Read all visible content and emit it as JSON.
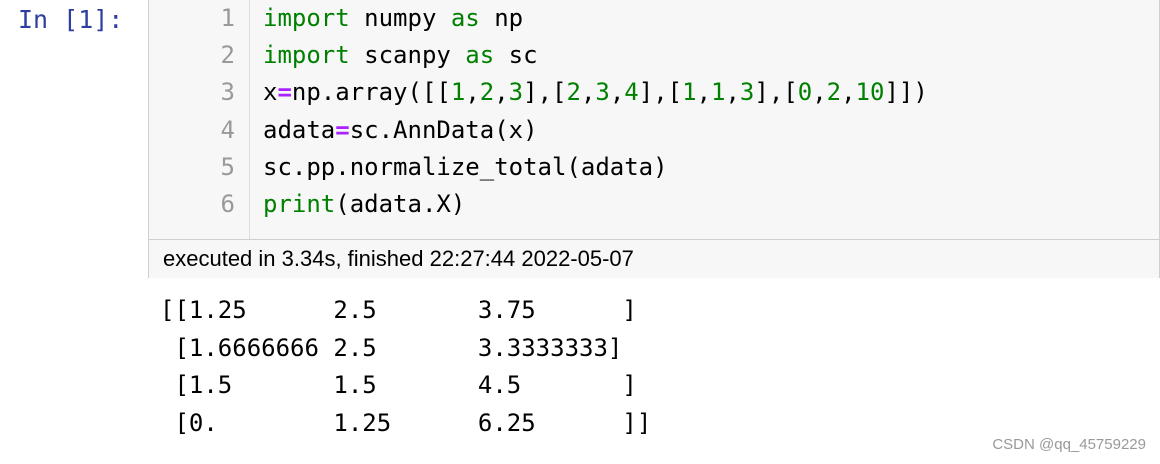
{
  "cell": {
    "prompt": "In [1]:",
    "line_numbers": [
      "1",
      "2",
      "3",
      "4",
      "5",
      "6"
    ],
    "code_lines": [
      [
        {
          "t": "import",
          "c": "kw"
        },
        {
          "t": " numpy ",
          "c": ""
        },
        {
          "t": "as",
          "c": "kw"
        },
        {
          "t": " np",
          "c": ""
        }
      ],
      [
        {
          "t": "import",
          "c": "kw"
        },
        {
          "t": " scanpy ",
          "c": ""
        },
        {
          "t": "as",
          "c": "kw"
        },
        {
          "t": " sc",
          "c": ""
        }
      ],
      [
        {
          "t": "x",
          "c": ""
        },
        {
          "t": "=",
          "c": "op"
        },
        {
          "t": "np.array([[",
          "c": ""
        },
        {
          "t": "1",
          "c": "num"
        },
        {
          "t": ",",
          "c": ""
        },
        {
          "t": "2",
          "c": "num"
        },
        {
          "t": ",",
          "c": ""
        },
        {
          "t": "3",
          "c": "num"
        },
        {
          "t": "],[",
          "c": ""
        },
        {
          "t": "2",
          "c": "num"
        },
        {
          "t": ",",
          "c": ""
        },
        {
          "t": "3",
          "c": "num"
        },
        {
          "t": ",",
          "c": ""
        },
        {
          "t": "4",
          "c": "num"
        },
        {
          "t": "],[",
          "c": ""
        },
        {
          "t": "1",
          "c": "num"
        },
        {
          "t": ",",
          "c": ""
        },
        {
          "t": "1",
          "c": "num"
        },
        {
          "t": ",",
          "c": ""
        },
        {
          "t": "3",
          "c": "num"
        },
        {
          "t": "],[",
          "c": ""
        },
        {
          "t": "0",
          "c": "num"
        },
        {
          "t": ",",
          "c": ""
        },
        {
          "t": "2",
          "c": "num"
        },
        {
          "t": ",",
          "c": ""
        },
        {
          "t": "10",
          "c": "num"
        },
        {
          "t": "]])",
          "c": ""
        }
      ],
      [
        {
          "t": "adata",
          "c": ""
        },
        {
          "t": "=",
          "c": "op"
        },
        {
          "t": "sc.AnnData(x)",
          "c": ""
        }
      ],
      [
        {
          "t": "sc.pp.normalize_total(adata)",
          "c": ""
        }
      ],
      [
        {
          "t": "print",
          "c": "kw"
        },
        {
          "t": "(adata.X)",
          "c": ""
        }
      ]
    ],
    "execution_info": "executed in 3.34s, finished 22:27:44 2022-05-07"
  },
  "output": {
    "lines": [
      "[[1.25      2.5       3.75      ]",
      " [1.6666666 2.5       3.3333333]",
      " [1.5       1.5       4.5       ]",
      " [0.        1.25      6.25      ]]"
    ]
  },
  "watermark": "CSDN @qq_45759229",
  "colors": {
    "keyword": "#008000",
    "operator": "#aa22ff",
    "number": "#008000",
    "prompt": "#303f9f",
    "cell_background": "#f7f7f7",
    "line_number": "#999999"
  }
}
